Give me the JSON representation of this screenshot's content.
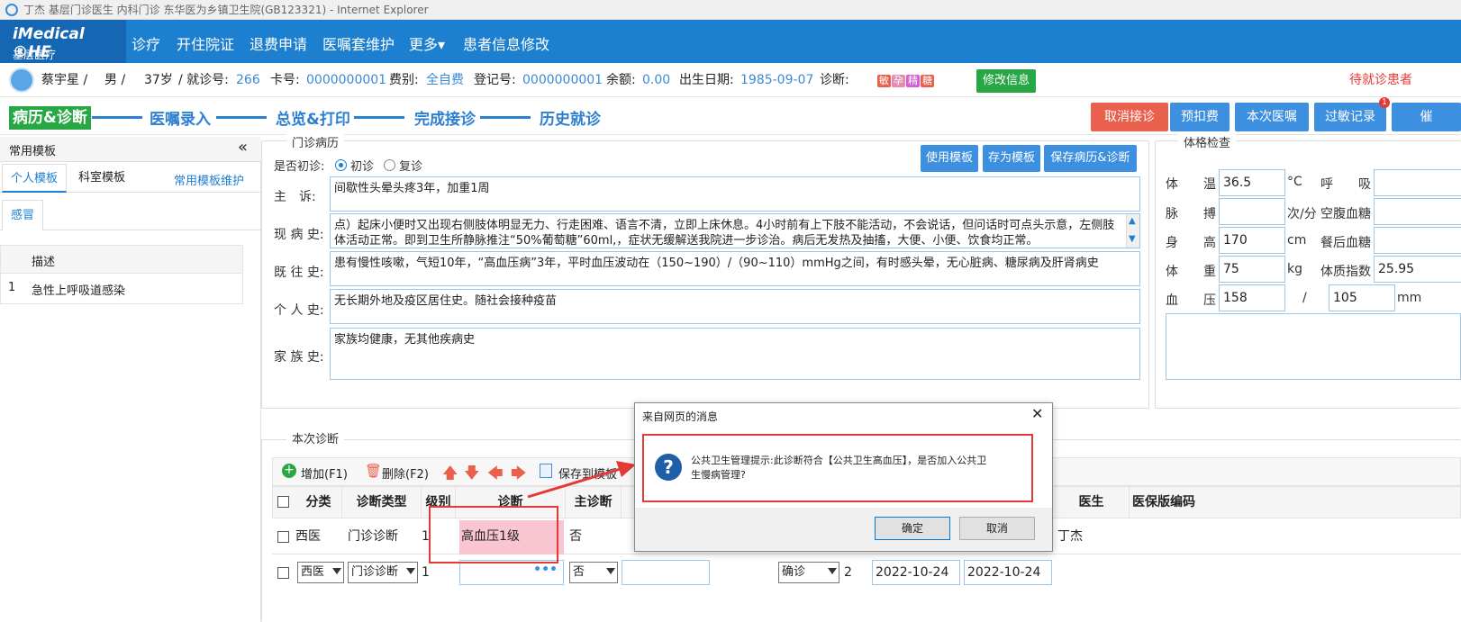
{
  "window": {
    "title": "丁杰 基层门诊医生 内科门诊 东华医为乡镇卫生院(GB123321) - Internet Explorer"
  },
  "header": {
    "logo_line1": "iMedical ®HE",
    "logo_line2": "基层医疗",
    "nav": [
      "诊疗",
      "开住院证",
      "退费申请",
      "医嘱套维护",
      "更多▾",
      "患者信息修改"
    ]
  },
  "patient": {
    "name": "蔡宇星 /",
    "sex": "男 /",
    "age": "37岁",
    "visit_label": "/ 就诊号:",
    "visit_no": "266",
    "card_label": "卡号:",
    "card_no": "0000000001",
    "fee_label": "费别:",
    "fee_type": "全自费",
    "reg_label": "登记号:",
    "reg_no": "0000000001",
    "balance_label": "余额:",
    "balance": "0.00",
    "dob_label": "出生日期:",
    "dob": "1985-09-07",
    "diag_label": "诊断:",
    "tags": [
      "敏",
      "孕",
      "精",
      "糖"
    ],
    "edit_button": "修改信息",
    "waiting": "待就诊患者"
  },
  "steps": {
    "items": [
      "病历&诊断",
      "医嘱录入",
      "总览&打印",
      "完成接诊",
      "历史就诊"
    ],
    "buttons": [
      "取消接诊",
      "预扣费",
      "本次医嘱",
      "过敏记录",
      "催"
    ],
    "badge": "1"
  },
  "left": {
    "title": "常用模板",
    "collapse": "«",
    "tabs": [
      "个人模板",
      "科室模板"
    ],
    "maintain_link": "常用模板维护",
    "subtab": "感冒",
    "col_header": "描述",
    "rows": [
      {
        "no": "1",
        "desc": "急性上呼吸道感染"
      }
    ]
  },
  "record": {
    "legend": "门诊病历",
    "first_visit_label": "是否初诊:",
    "opt_first": "初诊",
    "opt_return": "复诊",
    "btn_use_template": "使用模板",
    "btn_save_template": "存为模板",
    "btn_save_record": "保存病历&诊断",
    "chief_label": "主　诉:",
    "chief": "间歇性头晕头疼3年，加重1周",
    "present_label": "现 病 史:",
    "present": "点）起床小便时又出现右侧肢体明显无力、行走困难、语言不清，立即上床休息。4小时前有上下肢不能活动，不会说话，但问话时可点头示意，左侧肢体活动正常。即到卫生所静脉推注“50%葡萄糖”60ml,，症状无缓解送我院进一步诊治。病后无发热及抽搐，大便、小便、饮食均正常。",
    "past_label": "既 往 史:",
    "past": "患有慢性咳嗽，气短10年，“高血压病”3年，平时血压波动在（150~190）/（90~110）mmHg之间，有时感头晕，无心脏病、糖尿病及肝肾病史",
    "personal_label": "个 人 史:",
    "personal": "无长期外地及疫区居住史。随社会接种疫苗",
    "family_label": "家 族 史:",
    "family": "家族均健康，无其他疾病史"
  },
  "exam": {
    "legend": "体格检查",
    "temp_label": "体　　温",
    "temp": "36.5",
    "temp_unit": "°C",
    "resp_label": "呼　　吸",
    "pulse_label": "脉　　搏",
    "pulse_unit": "次/分",
    "fbg_label": "空腹血糖",
    "height_label": "身　　高",
    "height": "170",
    "height_unit": "cm",
    "pbg_label": "餐后血糖",
    "weight_label": "体　　重",
    "weight": "75",
    "weight_unit": "kg",
    "bmi_label": "体质指数",
    "bmi": "25.95",
    "bp_label": "血　　压",
    "bp_sys": "158",
    "bp_sep": "/",
    "bp_dia": "105",
    "bp_unit": "mm"
  },
  "diagnosis": {
    "legend": "本次诊断",
    "toolbar": {
      "add": "增加(F1)",
      "delete": "删除(F2)",
      "save_template": "保存到模板"
    },
    "columns": [
      "分类",
      "诊断类型",
      "级别",
      "诊断",
      "主诊断",
      "医生",
      "医保版编码"
    ],
    "row1": {
      "category": "西医",
      "type": "门诊诊断",
      "level": "1",
      "diag": "高血压1级",
      "main": "否",
      "doctor": "丁杰"
    },
    "row2": {
      "category": "西医",
      "type": "门诊诊断",
      "level": "1",
      "main": "否",
      "status": "确诊",
      "num": "2",
      "date1": "2022-10-24",
      "date2": "2022-10-24"
    }
  },
  "dialog": {
    "title": "来自网页的消息",
    "message": "公共卫生管理提示:此诊断符合【公共卫生高血压】，是否加入公共卫生慢病管理?",
    "ok": "确定",
    "cancel": "取消"
  },
  "colors": {
    "header": "#1c7fd0",
    "active_step": "#28a745",
    "cancel_btn": "#e9604d",
    "blue_btn": "#3d8fe0",
    "highlight": "#f9c5d1",
    "annotation": "#e53935"
  }
}
